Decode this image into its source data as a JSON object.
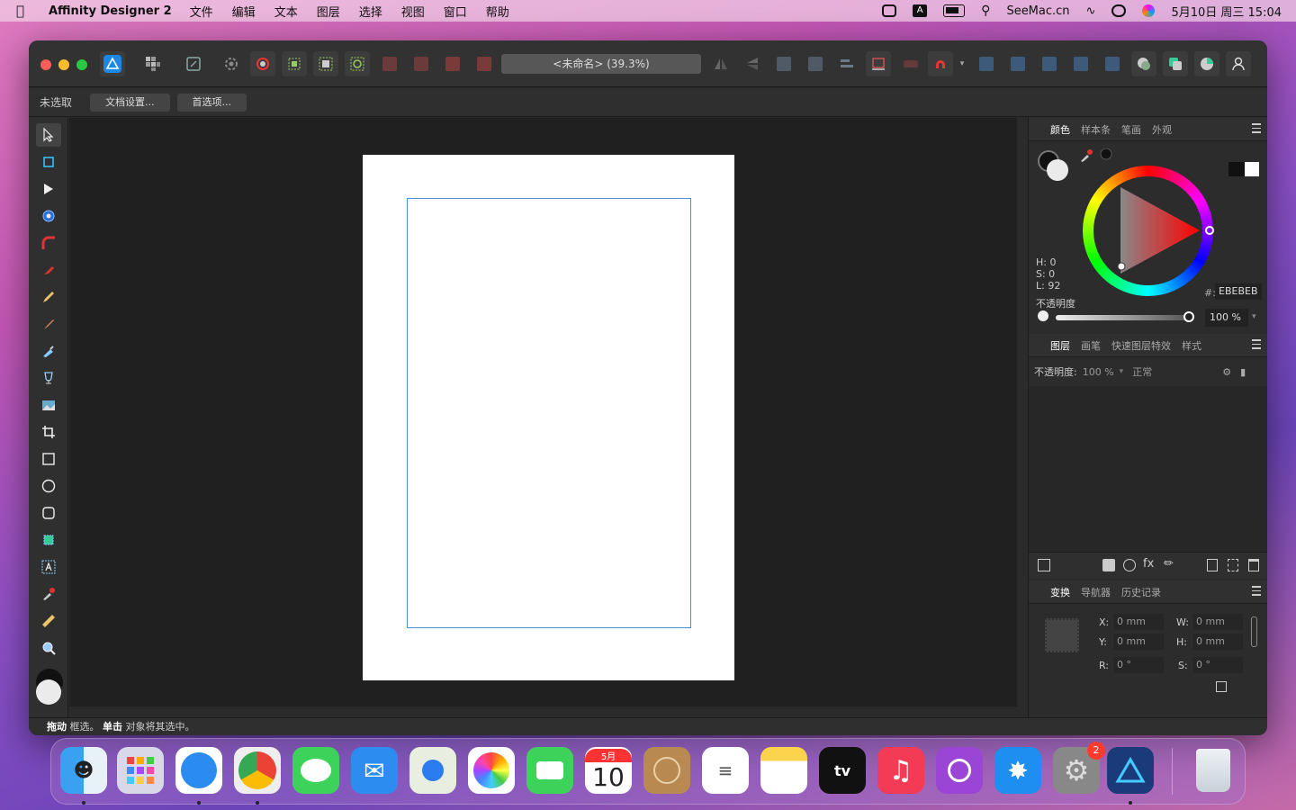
{
  "menubar": {
    "app_name": "Affinity Designer 2",
    "menus": [
      "文件",
      "编辑",
      "文本",
      "图层",
      "选择",
      "视图",
      "窗口",
      "帮助"
    ],
    "right_brand": "SeeMac.cn",
    "datetime": "5月10日 周三 15:04",
    "input_method": "A"
  },
  "window": {
    "doc_title": "<未命名> (39.3%)",
    "context": {
      "status": "未选取",
      "doc_settings_label": "文档设置...",
      "preferences_label": "首选项..."
    },
    "status_bar": {
      "drag_bold": "拖动",
      "drag_text": " 框选。",
      "click_bold": "单击",
      "click_text": " 对象将其选中。"
    }
  },
  "panels": {
    "color": {
      "tabs": [
        "颜色",
        "样本条",
        "笔画",
        "外观"
      ],
      "h": "H: 0",
      "s": "S: 0",
      "l": "L: 92",
      "hex_label": "#:",
      "hex": "EBEBEB",
      "opacity_label": "不透明度",
      "opacity": "100 %"
    },
    "layers": {
      "tabs": [
        "图层",
        "画笔",
        "快速图层特效",
        "样式"
      ],
      "opacity_label": "不透明度:",
      "opacity": "100 %",
      "blend": "正常"
    },
    "transform": {
      "tabs": [
        "变换",
        "导航器",
        "历史记录"
      ],
      "x_label": "X:",
      "x": "0 mm",
      "y_label": "Y:",
      "y": "0 mm",
      "w_label": "W:",
      "w": "0 mm",
      "h_label": "H:",
      "h": "0 mm",
      "r_label": "R:",
      "r": "0 °",
      "s_label": "S:",
      "s": "0 °"
    }
  },
  "dock": {
    "calendar_month": "5月",
    "calendar_day": "10",
    "settings_badge": "2",
    "tv_label": "tv"
  },
  "colors": {
    "accent": "#4a90d9",
    "canvas": "#202020",
    "panel": "#2c2c2c"
  }
}
